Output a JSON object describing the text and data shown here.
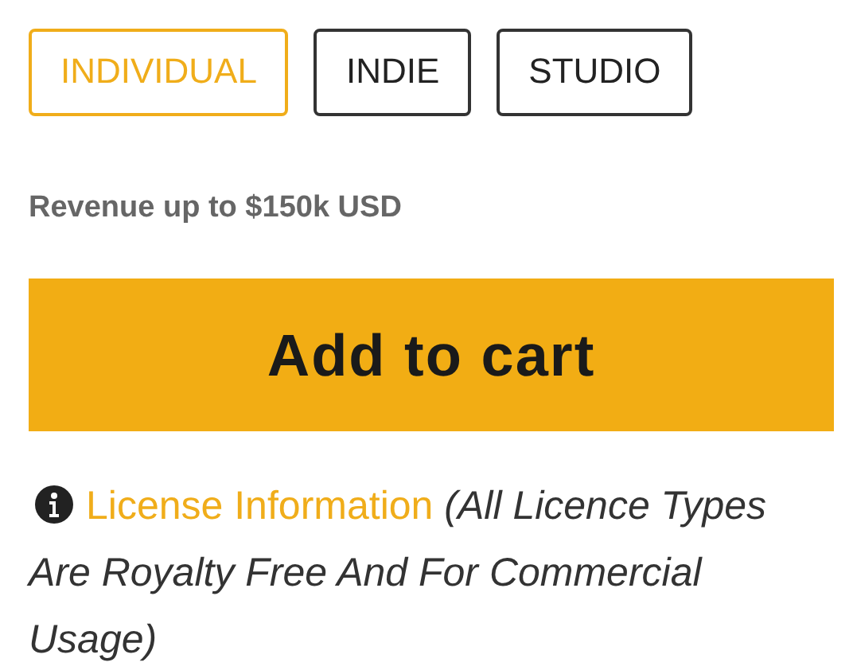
{
  "tiers": [
    {
      "label": "INDIVIDUAL",
      "selected": true
    },
    {
      "label": "INDIE",
      "selected": false
    },
    {
      "label": "STUDIO",
      "selected": false
    }
  ],
  "revenue": "Revenue up to $150k USD",
  "cart_button": "Add to cart",
  "license": {
    "link": "License Information",
    "note": "(All Licence Types Are Royalty Free And For Commercial Usage)"
  }
}
